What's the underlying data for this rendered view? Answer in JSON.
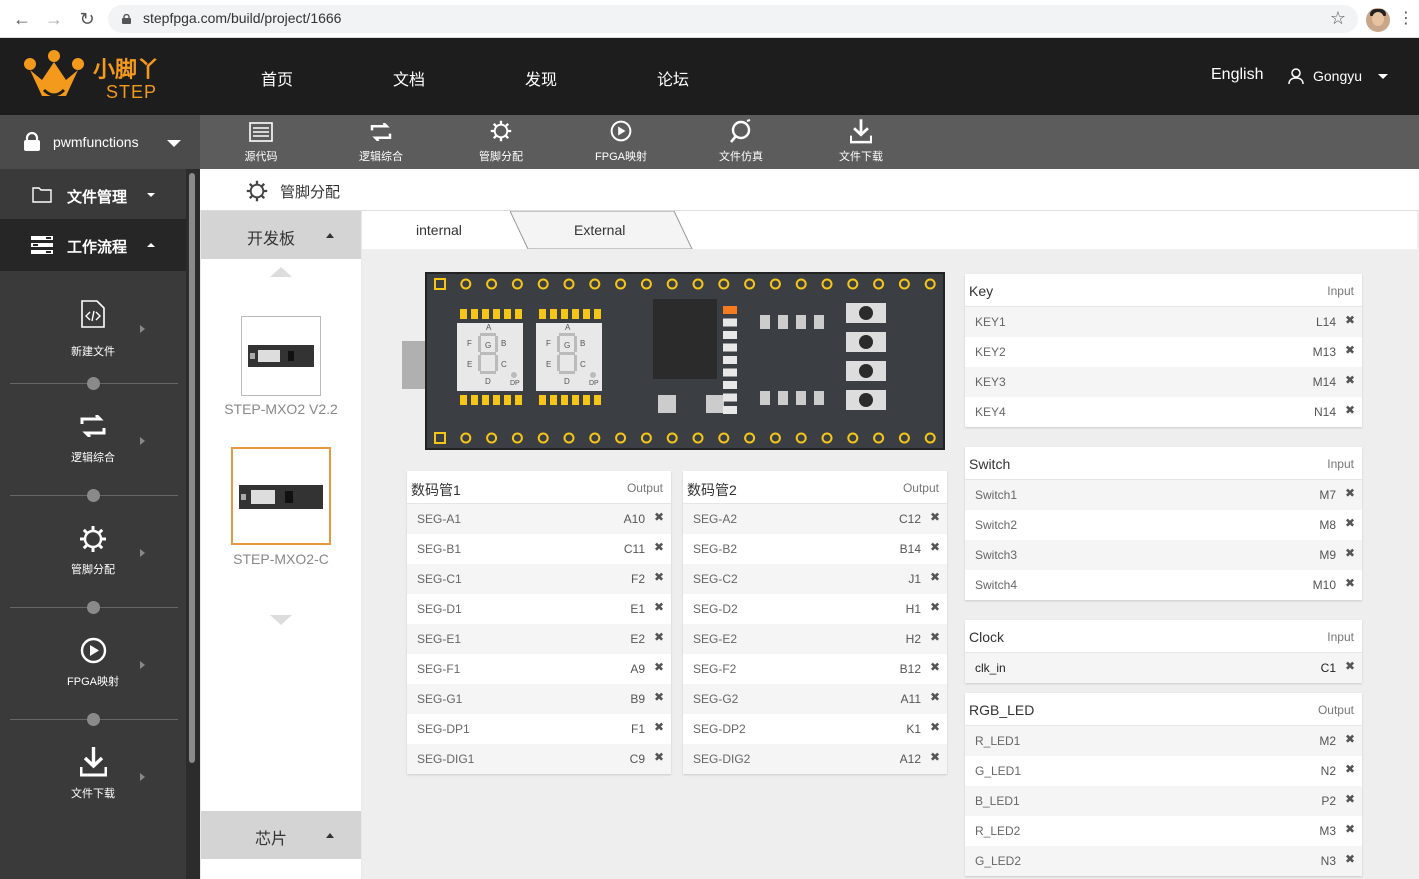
{
  "browser": {
    "url": "stepfpga.com/build/project/1666"
  },
  "brand": {
    "name": "小脚丫",
    "sub": "STEP",
    "accent": "#f39a1c"
  },
  "nav": {
    "items": [
      "首页",
      "文档",
      "发现",
      "论坛"
    ],
    "language": "English",
    "username": "Gongyu"
  },
  "sidebar": {
    "project": "pwmfunctions",
    "sections": [
      {
        "label": "文件管理"
      },
      {
        "label": "工作流程"
      }
    ],
    "workflow": [
      "新建文件",
      "逻辑综合",
      "管脚分配",
      "FPGA映射",
      "文件下载"
    ]
  },
  "toolbar": {
    "items": [
      "源代码",
      "逻辑综合",
      "管脚分配",
      "FPGA映射",
      "文件仿真",
      "文件下载"
    ]
  },
  "page": {
    "title": "管脚分配"
  },
  "boards": {
    "header": "开发板",
    "items": [
      "STEP-MXO2 V2.2",
      "STEP-MXO2-C"
    ],
    "chip_header": "芯片"
  },
  "tabs": [
    "internal",
    "External"
  ],
  "board_image": {
    "seg_letters": [
      "A",
      "F",
      "G",
      "B",
      "E",
      "C",
      "D",
      "DP"
    ]
  },
  "cards": {
    "seg1": {
      "title": "数码管1",
      "dir": "Output",
      "rows": [
        {
          "name": "SEG-A1",
          "pin": "A10"
        },
        {
          "name": "SEG-B1",
          "pin": "C11"
        },
        {
          "name": "SEG-C1",
          "pin": "F2"
        },
        {
          "name": "SEG-D1",
          "pin": "E1"
        },
        {
          "name": "SEG-E1",
          "pin": "E2"
        },
        {
          "name": "SEG-F1",
          "pin": "A9"
        },
        {
          "name": "SEG-G1",
          "pin": "B9"
        },
        {
          "name": "SEG-DP1",
          "pin": "F1"
        },
        {
          "name": "SEG-DIG1",
          "pin": "C9"
        }
      ]
    },
    "seg2": {
      "title": "数码管2",
      "dir": "Output",
      "rows": [
        {
          "name": "SEG-A2",
          "pin": "C12"
        },
        {
          "name": "SEG-B2",
          "pin": "B14"
        },
        {
          "name": "SEG-C2",
          "pin": "J1"
        },
        {
          "name": "SEG-D2",
          "pin": "H1"
        },
        {
          "name": "SEG-E2",
          "pin": "H2"
        },
        {
          "name": "SEG-F2",
          "pin": "B12"
        },
        {
          "name": "SEG-G2",
          "pin": "A11"
        },
        {
          "name": "SEG-DP2",
          "pin": "K1"
        },
        {
          "name": "SEG-DIG2",
          "pin": "A12"
        }
      ]
    },
    "key": {
      "title": "Key",
      "dir": "Input",
      "rows": [
        {
          "name": "KEY1",
          "pin": "L14"
        },
        {
          "name": "KEY2",
          "pin": "M13"
        },
        {
          "name": "KEY3",
          "pin": "M14"
        },
        {
          "name": "KEY4",
          "pin": "N14"
        }
      ]
    },
    "switch": {
      "title": "Switch",
      "dir": "Input",
      "rows": [
        {
          "name": "Switch1",
          "pin": "M7"
        },
        {
          "name": "Switch2",
          "pin": "M8"
        },
        {
          "name": "Switch3",
          "pin": "M9"
        },
        {
          "name": "Switch4",
          "pin": "M10"
        }
      ]
    },
    "clock": {
      "title": "Clock",
      "dir": "Input",
      "rows": [
        {
          "name": "clk_in",
          "pin": "C1"
        }
      ]
    },
    "rgb": {
      "title": "RGB_LED",
      "dir": "Output",
      "rows": [
        {
          "name": "R_LED1",
          "pin": "M2"
        },
        {
          "name": "G_LED1",
          "pin": "N2"
        },
        {
          "name": "B_LED1",
          "pin": "P2"
        },
        {
          "name": "R_LED2",
          "pin": "M3"
        },
        {
          "name": "G_LED2",
          "pin": "N3"
        }
      ]
    }
  },
  "remove_glyph": "✖"
}
